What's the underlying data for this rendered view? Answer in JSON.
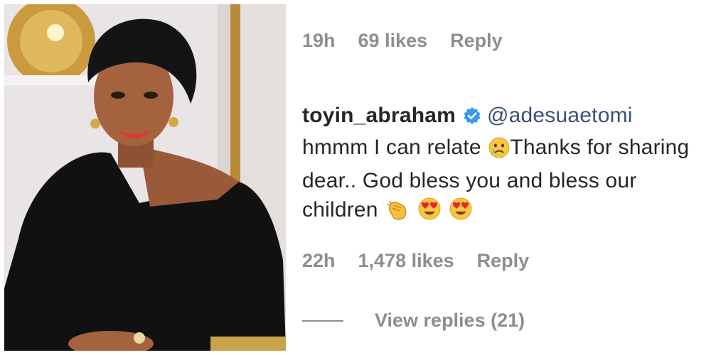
{
  "previous_comment": {
    "time": "19h",
    "likes": "69 likes",
    "reply_label": "Reply"
  },
  "comment": {
    "username": "toyin_abraham",
    "mention": "@adesuaetomi",
    "text_part1": "hmmm I can relate",
    "text_part2": "Thanks for sharing dear.. God bless you and bless our children",
    "emojis": [
      "crying-face",
      "clapping-hands",
      "heart-eyes",
      "heart-eyes"
    ],
    "time": "22h",
    "likes": "1,478 likes",
    "reply_label": "Reply",
    "view_replies_label": "View replies (21)"
  },
  "colors": {
    "username": "#262626",
    "mention": "#3b4f7a",
    "meta": "#8e8e8e",
    "verified_badge": "#3897f0"
  }
}
